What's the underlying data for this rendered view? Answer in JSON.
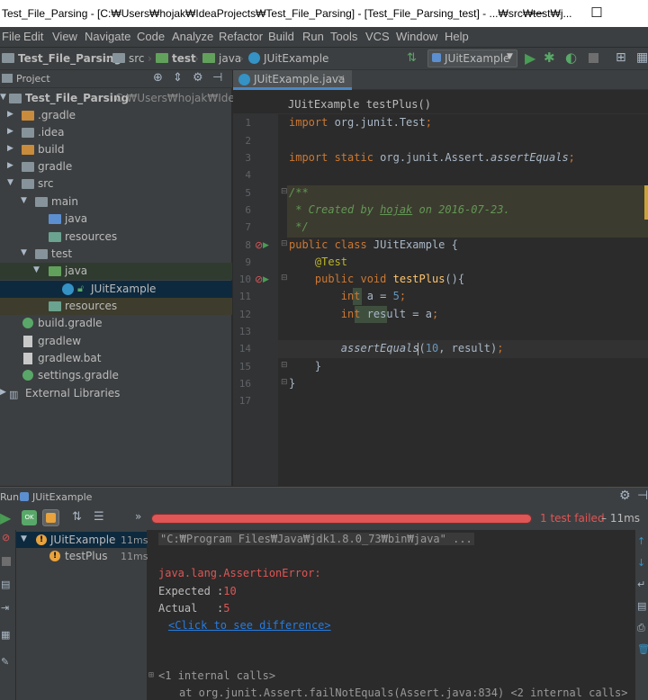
{
  "window": {
    "title": "Test_File_Parsing - [C:₩Users₩hojak₩IdeaProjects₩Test_File_Parsing] - [Test_File_Parsing_test] - ...₩src₩test₩j...",
    "minimize": "—",
    "maximize": "☐"
  },
  "menu": [
    "File",
    "Edit",
    "View",
    "Navigate",
    "Code",
    "Analyze",
    "Refactor",
    "Build",
    "Run",
    "Tools",
    "VCS",
    "Window",
    "Help"
  ],
  "breadcrumbs": [
    "Test_File_Parsing",
    "src",
    "test",
    "java",
    "JUitExample"
  ],
  "run_config": "JUitExample",
  "project_panel": {
    "title": "Project",
    "root_label": "Test_File_Parsing",
    "root_path": "C:₩Users₩hojak₩IdeaPro",
    "items": [
      {
        "label": ".gradle"
      },
      {
        "label": ".idea"
      },
      {
        "label": "build"
      },
      {
        "label": "gradle"
      },
      {
        "label": "src"
      },
      {
        "label": "main"
      },
      {
        "label": "java"
      },
      {
        "label": "resources"
      },
      {
        "label": "test"
      },
      {
        "label": "java"
      },
      {
        "label": "JUitExample"
      },
      {
        "label": "resources"
      },
      {
        "label": "build.gradle"
      },
      {
        "label": "gradlew"
      },
      {
        "label": "gradlew.bat"
      },
      {
        "label": "settings.gradle"
      },
      {
        "label": "External Libraries"
      }
    ]
  },
  "editor": {
    "tab_label": "JUitExample.java",
    "breadcrumb": "JUitExample  testPlus()",
    "line_numbers": [
      "1",
      "2",
      "3",
      "4",
      "5",
      "6",
      "7",
      "8",
      "9",
      "10",
      "11",
      "12",
      "13",
      "14",
      "15",
      "16",
      "17"
    ]
  },
  "run_panel": {
    "title": "Run",
    "config": "JUitExample",
    "status": "1 test failed",
    "duration": "– 11ms",
    "tests": [
      {
        "label": "JUitExample",
        "time": "11ms"
      },
      {
        "label": "testPlus",
        "time": "11ms"
      }
    ],
    "console": {
      "cmd": "\"C:₩Program Files₩Java₩jdk1.8.0_73₩bin₩java\" ...",
      "error": "java.lang.AssertionError:",
      "expected_label": "Expected :",
      "expected_value": "10",
      "actual_label": "Actual   :",
      "actual_value": "5",
      "diff_link": "<Click to see difference>",
      "internal": "<1 internal calls>",
      "trace": "at org.junit.Assert.failNotEquals(Assert.java:834) <2 internal calls>"
    }
  },
  "colors": {
    "fail_bar": "#e05555",
    "fail_text": "#e05555",
    "link": "#287bde"
  }
}
